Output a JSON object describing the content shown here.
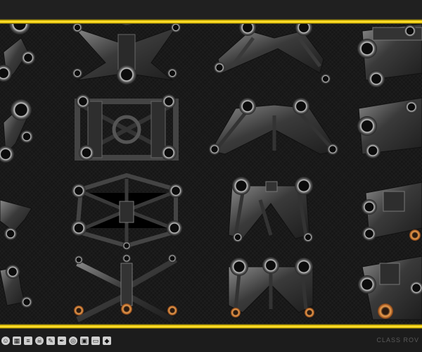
{
  "watermark": "CLASS ROV",
  "toolbar": {
    "icons": [
      "user-icon",
      "grid-icon",
      "list-icon",
      "skull-icon",
      "brush-icon",
      "pen-icon",
      "target-icon",
      "image-icon",
      "window-icon",
      "stamp-icon"
    ]
  },
  "colors": {
    "accent_yellow": "#f5d000",
    "background": "#151515",
    "metal_dark": "#2c2c2c",
    "metal_light": "#9a9a9a",
    "copper": "#d07a2a"
  }
}
